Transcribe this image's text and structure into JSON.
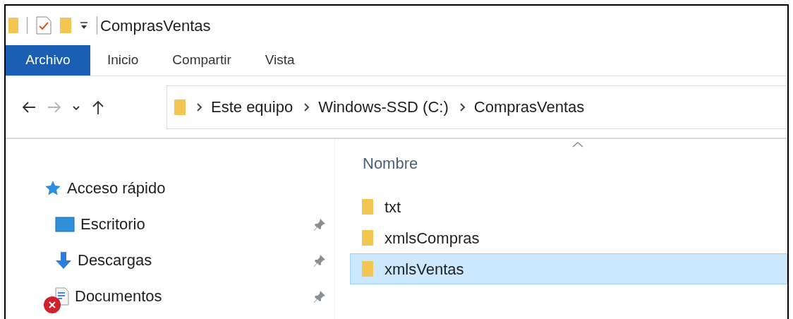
{
  "window": {
    "title": "ComprasVentas"
  },
  "ribbon_tabs": [
    {
      "label": "Archivo",
      "kind": "file"
    },
    {
      "label": "Inicio",
      "kind": "tab"
    },
    {
      "label": "Compartir",
      "kind": "tab"
    },
    {
      "label": "Vista",
      "kind": "tab"
    }
  ],
  "navigation": [
    {
      "kind": "back",
      "disabled": false
    },
    {
      "kind": "forward",
      "disabled": true
    },
    {
      "kind": "recent",
      "disabled": false
    },
    {
      "kind": "up",
      "disabled": false
    }
  ],
  "address_bar": {
    "path": [
      "Este equipo",
      "Windows-SSD (C:)",
      "ComprasVentas"
    ]
  },
  "sidebar": {
    "items": [
      {
        "label": "Acceso rápido",
        "pinned": false,
        "error": false
      },
      {
        "label": "Escritorio",
        "pinned": true,
        "error": false
      },
      {
        "label": "Descargas",
        "pinned": true,
        "error": false
      },
      {
        "label": "Documentos",
        "pinned": true,
        "error": true
      }
    ]
  },
  "file_list": {
    "columns": [
      "Nombre"
    ],
    "rows": [
      {
        "name": "txt",
        "selected": false
      },
      {
        "name": "xmlsCompras",
        "selected": false
      },
      {
        "name": "xmlsVentas",
        "selected": true
      }
    ]
  }
}
